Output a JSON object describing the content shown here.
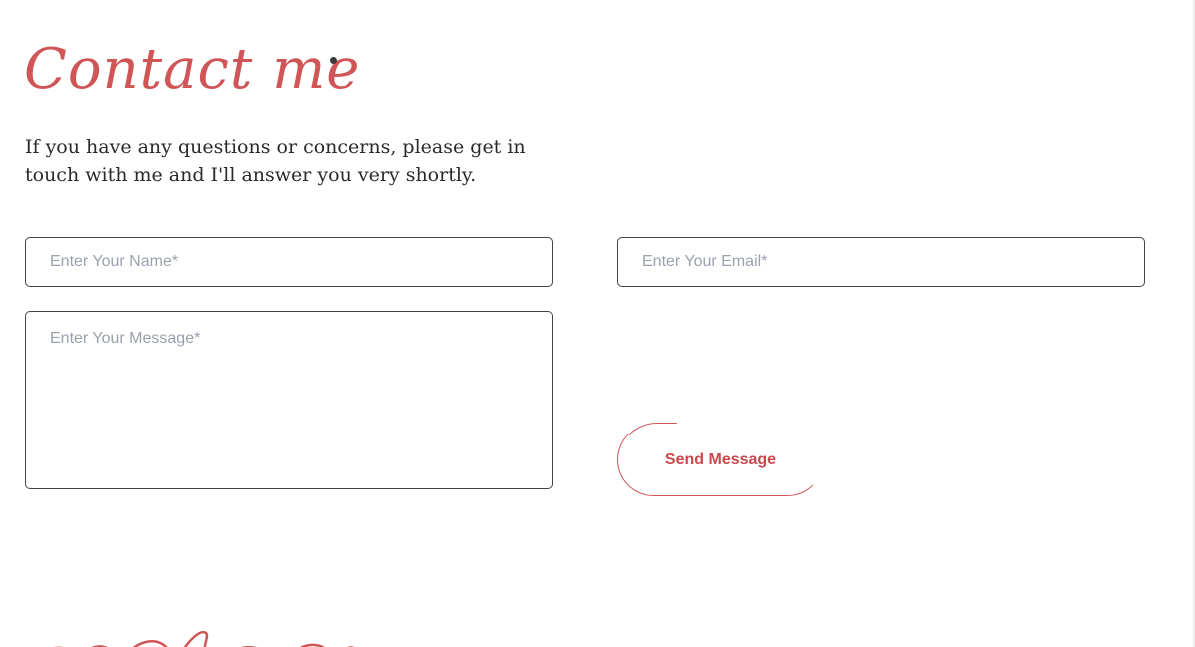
{
  "contact": {
    "title": "Contact me",
    "intro": "If you have any questions or concerns, please get in touch with me and I'll answer you very shortly.",
    "form": {
      "name_placeholder": "Enter Your Name*",
      "email_placeholder": "Enter Your Email*",
      "message_placeholder": "Enter Your Message*",
      "submit_label": "Send Message"
    }
  },
  "colors": {
    "accent": "#d05557",
    "text": "#2a2a2a",
    "placeholder": "#9aa1ad",
    "border": "#444444"
  }
}
